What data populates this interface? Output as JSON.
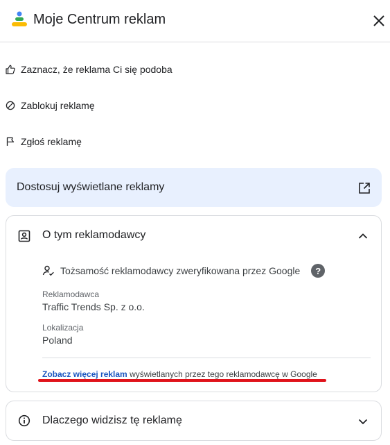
{
  "header": {
    "title": "Moje Centrum reklam",
    "logo_icon": "my-ad-center-logo",
    "close_icon": "close-icon"
  },
  "actions": [
    {
      "label": "Zaznacz, że reklama Ci się podoba",
      "icon": "thumb-up-icon"
    },
    {
      "label": "Zablokuj reklamę",
      "icon": "block-icon"
    },
    {
      "label": "Zgłoś reklamę",
      "icon": "flag-icon"
    }
  ],
  "customize": {
    "label": "Dostosuj wyświetlane reklamy",
    "icon": "open-in-new-icon"
  },
  "advertiser": {
    "title": "O tym reklamodawcy",
    "verified_text": "Tożsamość reklamodawcy zweryfikowana przez Google",
    "help_glyph": "?",
    "advertiser_label": "Reklamodawca",
    "advertiser_value": "Traffic Trends Sp. z o.o.",
    "location_label": "Lokalizacja",
    "location_value": "Poland",
    "more_link": "Zobacz więcej reklam",
    "more_text": " wyświetlanych przez tego reklamodawcę w Google"
  },
  "why": {
    "title": "Dlaczego widzisz tę reklamę",
    "icon": "info-icon"
  },
  "colors": {
    "accent_bg": "#e8f0fe",
    "link": "#1a56c0",
    "annotation": "#e0131b",
    "border": "#dadce0"
  }
}
